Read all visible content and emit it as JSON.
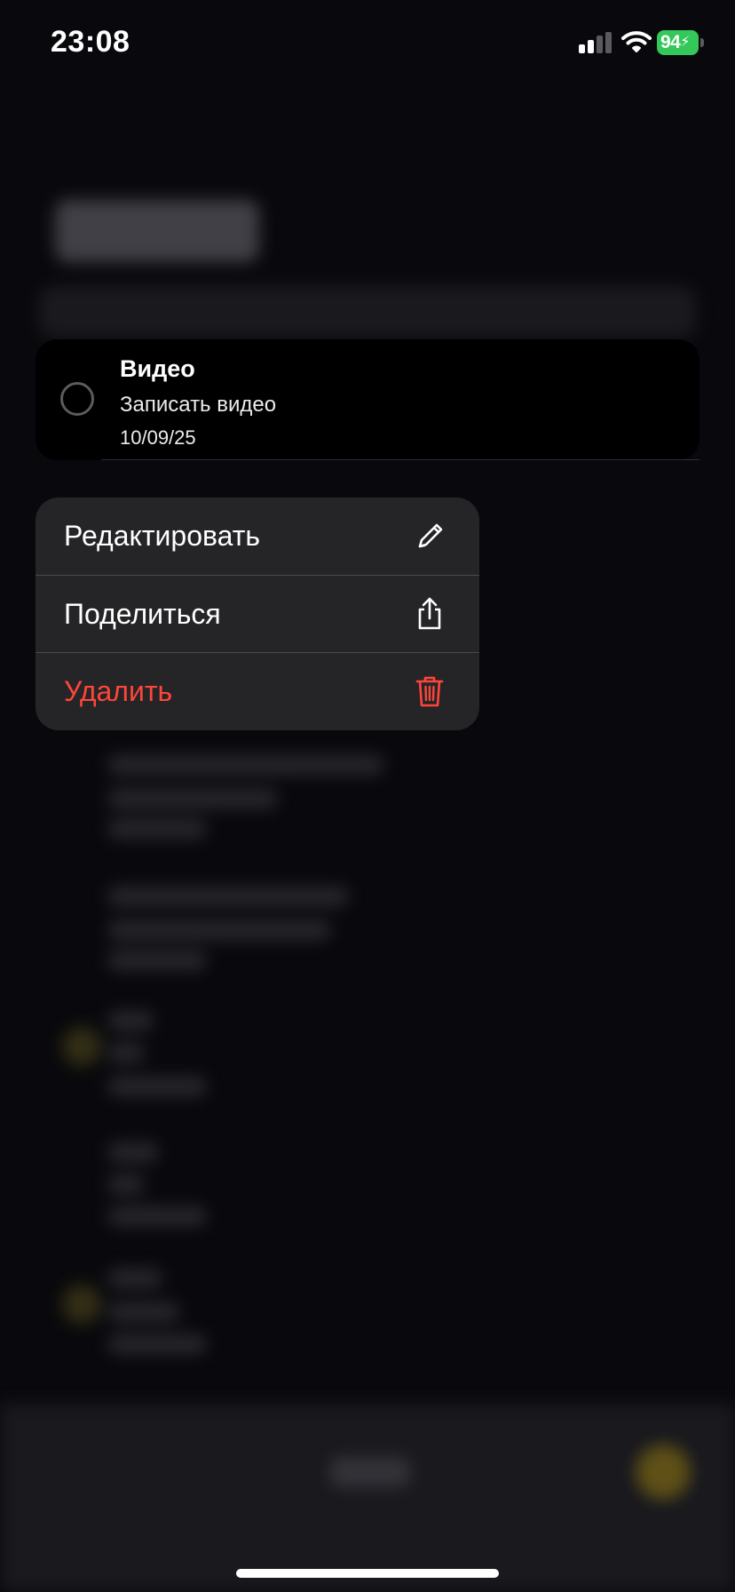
{
  "status_bar": {
    "time": "23:08",
    "battery_level": "94",
    "battery_charging": true,
    "signal_bars_filled": 2,
    "signal_bars_total": 4,
    "wifi": true
  },
  "task": {
    "title": "Видео",
    "subtitle": "Записать видео",
    "date": "10/09/25",
    "completed": false
  },
  "context_menu": {
    "items": [
      {
        "label": "Редактировать",
        "icon": "pencil-icon",
        "destructive": false
      },
      {
        "label": "Поделиться",
        "icon": "share-icon",
        "destructive": false
      },
      {
        "label": "Удалить",
        "icon": "trash-icon",
        "destructive": true
      }
    ]
  },
  "colors": {
    "background": "#09090d",
    "menu_background": "#252528",
    "destructive": "#ff453a",
    "battery": "#34c759",
    "accent_fab": "#6d5d18"
  }
}
